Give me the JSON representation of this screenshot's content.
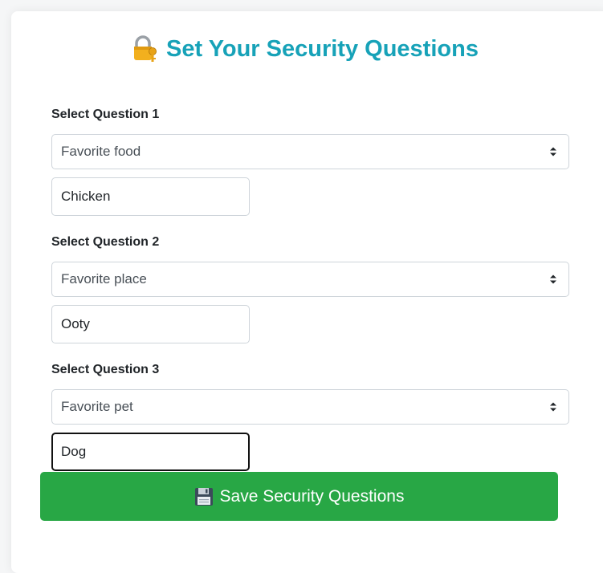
{
  "page": {
    "title": "Set Your Security Questions",
    "title_icon": "lock-with-key-icon",
    "accent_color": "#17a2b8"
  },
  "questions": [
    {
      "label": "Select Question 1",
      "selected": "Favorite food",
      "answer": "Chicken"
    },
    {
      "label": "Select Question 2",
      "selected": "Favorite place",
      "answer": "Ooty"
    },
    {
      "label": "Select Question 3",
      "selected": "Favorite pet",
      "answer": "Dog"
    }
  ],
  "save_button": {
    "label": "Save Security Questions",
    "icon": "floppy-disk-icon",
    "color": "#28a745"
  }
}
